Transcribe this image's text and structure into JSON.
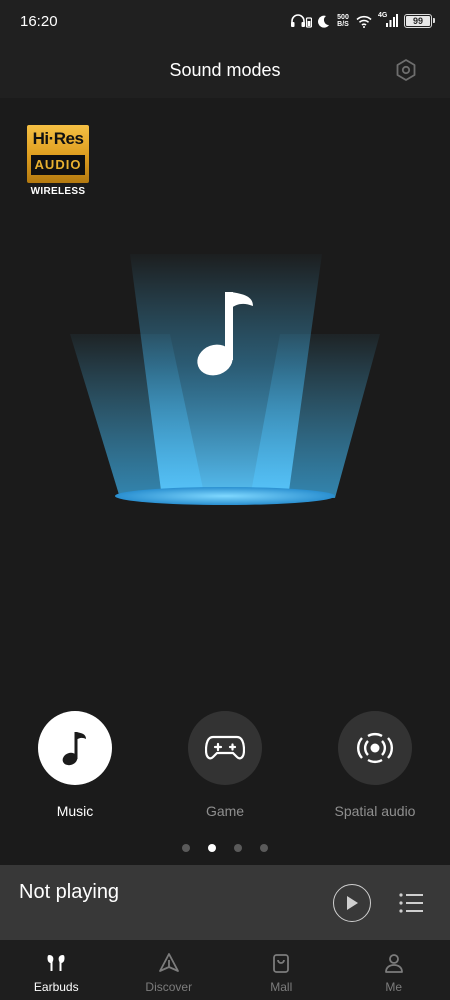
{
  "status_bar": {
    "time": "16:20",
    "net_speed_value": "500",
    "net_speed_unit": "B/S",
    "network_type": "4G",
    "battery": "99",
    "battery_level": 0.99,
    "icons": [
      "headphone-battery-icon",
      "moon-icon",
      "wifi-icon",
      "signal-icon",
      "battery-icon"
    ]
  },
  "header": {
    "title": "Sound modes",
    "settings_icon": "hexagon-settings-icon"
  },
  "badge": {
    "line1": "Hi·Res",
    "line2": "AUDIO",
    "line3": "WIRELESS"
  },
  "modes": [
    {
      "label": "Music",
      "icon": "music-note-icon",
      "active": true
    },
    {
      "label": "Game",
      "icon": "gamepad-icon",
      "active": false
    },
    {
      "label": "Spatial audio",
      "icon": "spatial-audio-icon",
      "active": false
    }
  ],
  "pager": {
    "count": 4,
    "active_index": 1
  },
  "player": {
    "status": "Not playing",
    "play_icon": "play-icon",
    "playlist_icon": "playlist-icon"
  },
  "bottom_nav": [
    {
      "label": "Earbuds",
      "icon": "earbuds-icon",
      "active": true
    },
    {
      "label": "Discover",
      "icon": "discover-icon",
      "active": false
    },
    {
      "label": "Mall",
      "icon": "shopping-bag-icon",
      "active": false
    },
    {
      "label": "Me",
      "icon": "person-icon",
      "active": false
    }
  ],
  "colors": {
    "background": "#202020",
    "beam_accent": "#4fc3f7",
    "badge_gold": "#e0a021",
    "active": "#ffffff",
    "inactive": "#7c7c7c"
  }
}
